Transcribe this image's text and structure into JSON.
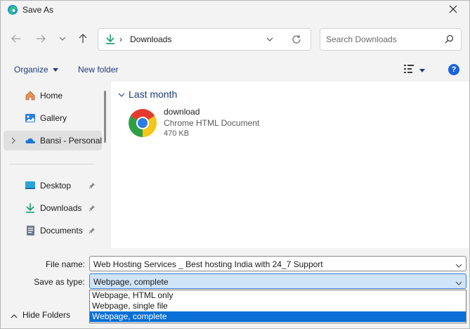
{
  "window": {
    "title": "Save As"
  },
  "navigation": {
    "back_icon": "arrow-left-icon",
    "forward_icon": "arrow-right-icon",
    "recent_icon": "chevron-down-icon",
    "up_icon": "arrow-up-icon"
  },
  "address": {
    "separator": "›",
    "path": "Downloads"
  },
  "search": {
    "placeholder": "Search Downloads"
  },
  "command_bar": {
    "organize_label": "Organize",
    "new_folder_label": "New folder",
    "help_label": "?"
  },
  "sidebar": {
    "items": [
      {
        "label": "Home",
        "icon": "home-icon",
        "pinned": false
      },
      {
        "label": "Gallery",
        "icon": "gallery-icon",
        "pinned": false
      },
      {
        "label": "Bansi - Personal",
        "icon": "onedrive-cloud-icon",
        "pinned": false,
        "selected": true,
        "expandable": true
      },
      {
        "label": "Desktop",
        "icon": "desktop-icon",
        "pinned": true
      },
      {
        "label": "Downloads",
        "icon": "downloads-icon",
        "pinned": true
      },
      {
        "label": "Documents",
        "icon": "documents-icon",
        "pinned": true
      }
    ]
  },
  "content": {
    "group_header": "Last month",
    "files": [
      {
        "name": "download",
        "type": "Chrome HTML Document",
        "size": "470 KB",
        "icon": "chrome-icon"
      }
    ]
  },
  "form": {
    "file_name_label": "File name:",
    "file_name_value": "Web Hosting Services _ Best hosting India with 24_7 Support",
    "save_type_label": "Save as type:",
    "save_type_value": "Webpage, complete",
    "save_type_options": [
      "Webpage, HTML only",
      "Webpage, single file",
      "Webpage, complete"
    ],
    "selected_option_index": 2
  },
  "footer": {
    "hide_folders_label": "Hide Folders"
  },
  "colors": {
    "accent": "#0a6fd6",
    "link_text": "#1f3a7a",
    "selected_field": "#cfe4f7"
  }
}
